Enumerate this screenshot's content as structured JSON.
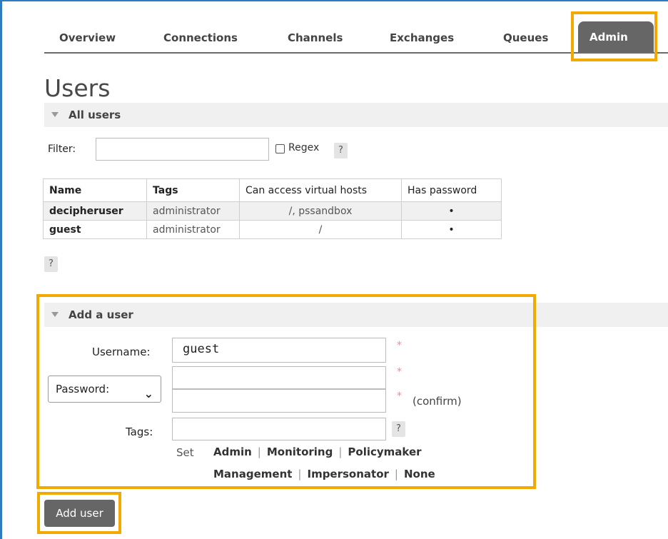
{
  "tabs": [
    {
      "label": "Overview"
    },
    {
      "label": "Connections"
    },
    {
      "label": "Channels"
    },
    {
      "label": "Exchanges"
    },
    {
      "label": "Queues"
    },
    {
      "label": "Admin",
      "active": true
    }
  ],
  "page": {
    "title": "Users"
  },
  "all_users": {
    "section_label": "All users",
    "filter_label": "Filter:",
    "filter_value": "",
    "regex_label": "Regex",
    "help_label": "?",
    "table": {
      "headers": [
        "Name",
        "Tags",
        "Can access virtual hosts",
        "Has password"
      ],
      "rows": [
        {
          "name": "decipheruser",
          "tags": "administrator",
          "vhosts": "/, pssandbox",
          "has_password": "•"
        },
        {
          "name": "guest",
          "tags": "administrator",
          "vhosts": "/",
          "has_password": "•"
        }
      ]
    },
    "table_help": "?"
  },
  "add_user": {
    "section_label": "Add a user",
    "username_label": "Username:",
    "username_value": "guest",
    "required_mark": "*",
    "password_select": "Password:",
    "password_value": "",
    "confirm_value": "",
    "confirm_label": "(confirm)",
    "tags_label": "Tags:",
    "tags_value": "",
    "tags_help": "?",
    "set_label": "Set",
    "tag_options": [
      "Admin",
      "Monitoring",
      "Policymaker",
      "Management",
      "Impersonator",
      "None"
    ],
    "separator": "|",
    "submit_label": "Add user"
  },
  "colors": {
    "highlight": "#f2a900",
    "tab_active": "#666666",
    "frame": "#2f7bbf",
    "required": "#f28b8b"
  }
}
